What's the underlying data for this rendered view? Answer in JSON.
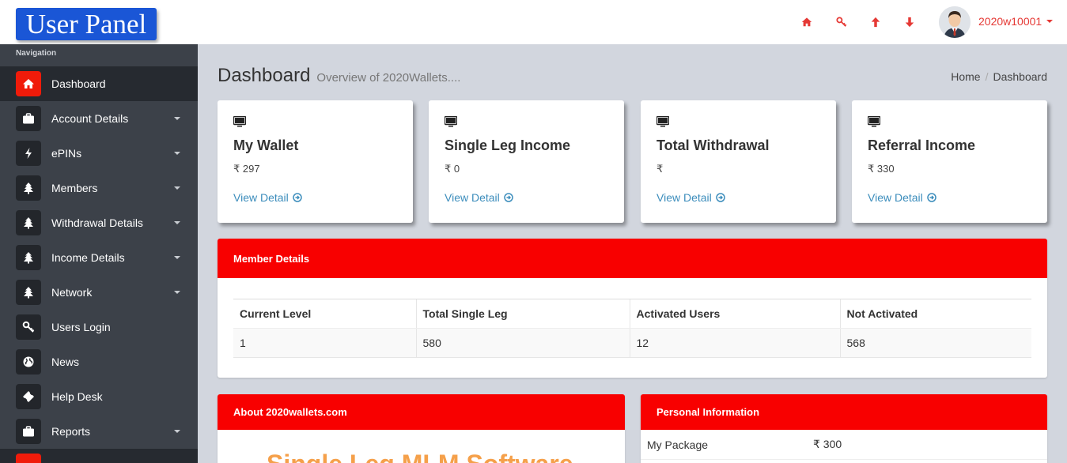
{
  "app": {
    "logo": "User Panel"
  },
  "topbar": {
    "icons": [
      "home-icon",
      "key-icon",
      "arrow-up-icon",
      "arrow-down-icon"
    ],
    "username": "2020w10001"
  },
  "sidebar": {
    "header": "Navigation",
    "items": [
      {
        "label": "Dashboard",
        "icon": "home-icon",
        "caret": false,
        "active": true
      },
      {
        "label": "Account Details",
        "icon": "briefcase-icon",
        "caret": true
      },
      {
        "label": "ePINs",
        "icon": "bolt-icon",
        "caret": true
      },
      {
        "label": "Members",
        "icon": "tree-icon",
        "caret": true
      },
      {
        "label": "Withdrawal Details",
        "icon": "tree-icon",
        "caret": true
      },
      {
        "label": "Income Details",
        "icon": "tree-icon",
        "caret": true
      },
      {
        "label": "Network",
        "icon": "tree-icon",
        "caret": true
      },
      {
        "label": "Users Login",
        "icon": "key-icon",
        "caret": false
      },
      {
        "label": "News",
        "icon": "globe-icon",
        "caret": false
      },
      {
        "label": "Help Desk",
        "icon": "ticket-icon",
        "caret": false
      },
      {
        "label": "Reports",
        "icon": "briefcase-icon",
        "caret": true
      }
    ]
  },
  "page": {
    "title": "Dashboard",
    "subtitle": "Overview of 2020Wallets...."
  },
  "breadcrumb": {
    "home": "Home",
    "sep": "/",
    "current": "Dashboard"
  },
  "cards": [
    {
      "title": "My Wallet",
      "value": "₹ 297",
      "link": "View Detail"
    },
    {
      "title": "Single Leg Income",
      "value": "₹ 0",
      "link": "View Detail"
    },
    {
      "title": "Total Withdrawal",
      "value": "₹",
      "link": "View Detail"
    },
    {
      "title": "Referral Income",
      "value": "₹ 330",
      "link": "View Detail"
    }
  ],
  "member_details": {
    "title": "Member Details",
    "headers": [
      "Current Level",
      "Total Single Leg",
      "Activated Users",
      "Not Activated"
    ],
    "row": [
      "1",
      "580",
      "12",
      "568"
    ]
  },
  "about": {
    "title": "About 2020wallets.com",
    "banner": "Single Leg MLM Software"
  },
  "personal_info": {
    "title": "Personal Information",
    "rows": [
      {
        "label": "My Package",
        "value": "₹ 300"
      }
    ]
  },
  "colors": {
    "accent_red": "#f80000",
    "sidebar_bg": "#3c4149",
    "link_blue": "#3c8dbc",
    "logo_blue": "#1a56d6"
  }
}
